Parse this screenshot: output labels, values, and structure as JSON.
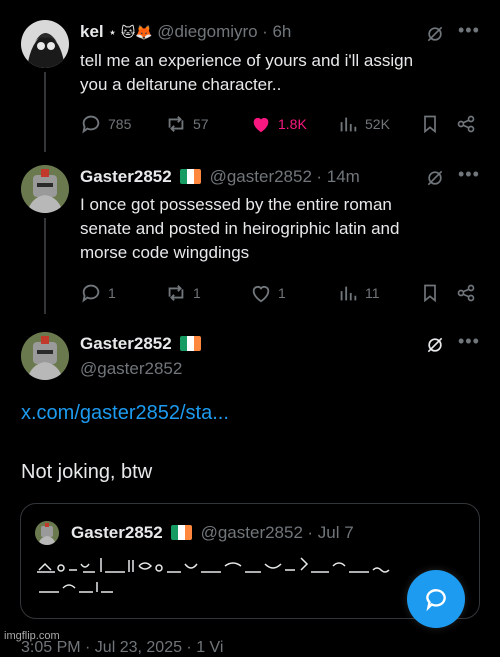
{
  "tweet1": {
    "name": "kel",
    "name_emojis": "⋆ 🐱🦊",
    "handle": "@diegomiyro",
    "time": "· 6h",
    "text_line1": "tell me an experience of yours and i'll assign",
    "text_line2": "you a deltarune character..",
    "replies": "785",
    "reposts": "57",
    "likes": "1.8K",
    "views": "52K"
  },
  "tweet2": {
    "name": "Gaster2852",
    "handle": "@gaster2852",
    "time": "· 14m",
    "text_line1": "I once got possessed by the entire roman",
    "text_line2": "senate and posted in heirogriphic latin and",
    "text_line3": "morse code wingdings",
    "replies": "1",
    "reposts": "1",
    "likes": "1",
    "views": "11"
  },
  "tweet3": {
    "name": "Gaster2852",
    "handle": "@gaster2852",
    "link": "x.com/gaster2852/sta...",
    "text": "Not joking, btw",
    "quote": {
      "name": "Gaster2852",
      "handle": "@gaster2852",
      "time": "· Jul 7"
    },
    "footer_partial": "3:05 PM · Jul 23, 2025 · 1 Vi"
  },
  "watermark": "imgflip.com",
  "colors": {
    "accent": "#1d9bf0",
    "like": "#f91880",
    "muted": "#71767b"
  },
  "icons": [
    "reply-icon",
    "repost-icon",
    "like-icon",
    "views-icon",
    "bookmark-icon",
    "share-icon",
    "grok-icon",
    "more-icon",
    "chat-icon"
  ]
}
